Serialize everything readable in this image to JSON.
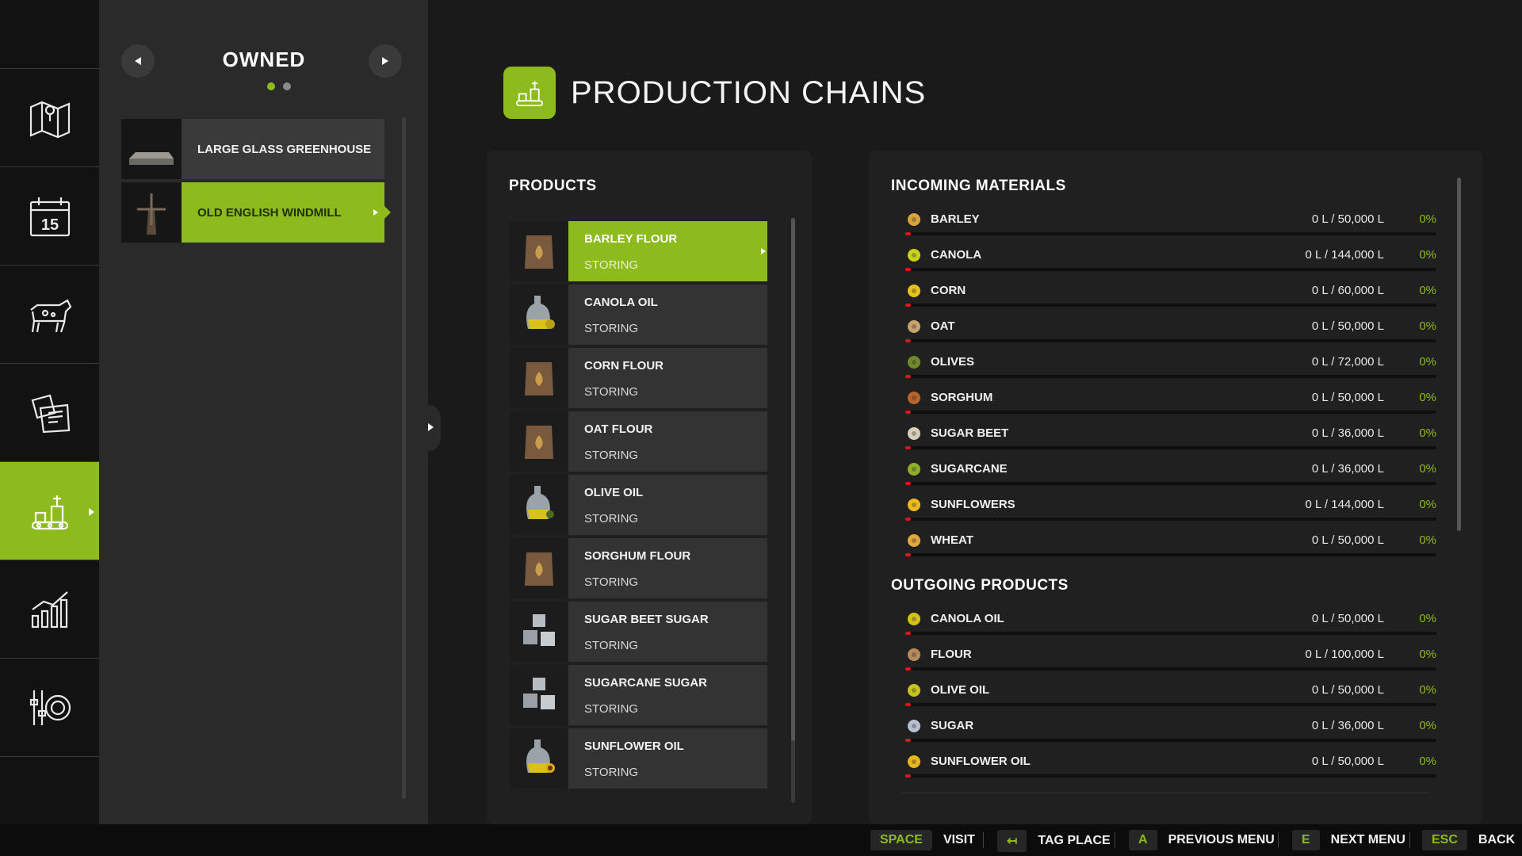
{
  "sidebar": {
    "items": [
      {
        "icon": "map-icon",
        "active": false
      },
      {
        "icon": "calendar-icon",
        "active": false
      },
      {
        "icon": "cow-icon",
        "active": false
      },
      {
        "icon": "contracts-icon",
        "active": false
      },
      {
        "icon": "production-icon",
        "active": true
      },
      {
        "icon": "statistics-icon",
        "active": false
      },
      {
        "icon": "settings-icon",
        "active": false
      }
    ],
    "calendar_day": "15"
  },
  "places": {
    "title": "OWNED",
    "items": [
      {
        "label": "LARGE GLASS GREENHOUSE",
        "active": false
      },
      {
        "label": "OLD ENGLISH WINDMILL",
        "active": true
      }
    ]
  },
  "main": {
    "title": "PRODUCTION CHAINS",
    "products_title": "PRODUCTS",
    "products": [
      {
        "name": "BARLEY FLOUR",
        "status": "STORING",
        "icon": "flour-sack-icon",
        "active": true
      },
      {
        "name": "CANOLA OIL",
        "status": "STORING",
        "icon": "oil-jug-icon",
        "active": false
      },
      {
        "name": "CORN FLOUR",
        "status": "STORING",
        "icon": "flour-sack-icon",
        "active": false
      },
      {
        "name": "OAT FLOUR",
        "status": "STORING",
        "icon": "flour-sack-icon",
        "active": false
      },
      {
        "name": "OLIVE OIL",
        "status": "STORING",
        "icon": "oil-jug-icon",
        "active": false
      },
      {
        "name": "SORGHUM FLOUR",
        "status": "STORING",
        "icon": "flour-sack-icon",
        "active": false
      },
      {
        "name": "SUGAR BEET SUGAR",
        "status": "STORING",
        "icon": "sugar-cubes-icon",
        "active": false
      },
      {
        "name": "SUGARCANE SUGAR",
        "status": "STORING",
        "icon": "sugar-cubes-icon",
        "active": false
      },
      {
        "name": "SUNFLOWER OIL",
        "status": "STORING",
        "icon": "oil-jug-icon",
        "active": false
      }
    ],
    "incoming_title": "INCOMING MATERIALS",
    "incoming": [
      {
        "name": "BARLEY",
        "value": "0 L / 50,000 L",
        "pct": "0%",
        "icon": "barley-icon",
        "fill": 0
      },
      {
        "name": "CANOLA",
        "value": "0 L / 144,000 L",
        "pct": "0%",
        "icon": "canola-icon",
        "fill": 0
      },
      {
        "name": "CORN",
        "value": "0 L / 60,000 L",
        "pct": "0%",
        "icon": "corn-icon",
        "fill": 0
      },
      {
        "name": "OAT",
        "value": "0 L / 50,000 L",
        "pct": "0%",
        "icon": "oat-icon",
        "fill": 0
      },
      {
        "name": "OLIVES",
        "value": "0 L / 72,000 L",
        "pct": "0%",
        "icon": "olives-icon",
        "fill": 0
      },
      {
        "name": "SORGHUM",
        "value": "0 L / 50,000 L",
        "pct": "0%",
        "icon": "sorghum-icon",
        "fill": 0
      },
      {
        "name": "SUGAR BEET",
        "value": "0 L / 36,000 L",
        "pct": "0%",
        "icon": "sugar-beet-icon",
        "fill": 0
      },
      {
        "name": "SUGARCANE",
        "value": "0 L / 36,000 L",
        "pct": "0%",
        "icon": "sugarcane-icon",
        "fill": 0
      },
      {
        "name": "SUNFLOWERS",
        "value": "0 L / 144,000 L",
        "pct": "0%",
        "icon": "sunflower-icon",
        "fill": 0
      },
      {
        "name": "WHEAT",
        "value": "0 L / 50,000 L",
        "pct": "0%",
        "icon": "wheat-icon",
        "fill": 0
      }
    ],
    "outgoing_title": "OUTGOING PRODUCTS",
    "outgoing": [
      {
        "name": "CANOLA OIL",
        "value": "0 L / 50,000 L",
        "pct": "0%",
        "icon": "canola-oil-icon",
        "fill": 0
      },
      {
        "name": "FLOUR",
        "value": "0 L / 100,000 L",
        "pct": "0%",
        "icon": "flour-icon",
        "fill": 0
      },
      {
        "name": "OLIVE OIL",
        "value": "0 L / 50,000 L",
        "pct": "0%",
        "icon": "olive-oil-icon",
        "fill": 0
      },
      {
        "name": "SUGAR",
        "value": "0 L / 36,000 L",
        "pct": "0%",
        "icon": "sugar-icon",
        "fill": 0
      },
      {
        "name": "SUNFLOWER OIL",
        "value": "0 L / 50,000 L",
        "pct": "0%",
        "icon": "sunflower-oil-icon",
        "fill": 0
      }
    ]
  },
  "footer": {
    "items": [
      {
        "key": "SPACE",
        "label": "VISIT"
      },
      {
        "key": "↤",
        "label": "TAG PLACE"
      },
      {
        "key": "A",
        "label": "PREVIOUS MENU"
      },
      {
        "key": "E",
        "label": "NEXT MENU"
      },
      {
        "key": "ESC",
        "label": "BACK"
      }
    ]
  },
  "colors": {
    "accent": "#8dbb1d",
    "bar_empty": "#e0151b",
    "percent": "#8dbb1d"
  }
}
